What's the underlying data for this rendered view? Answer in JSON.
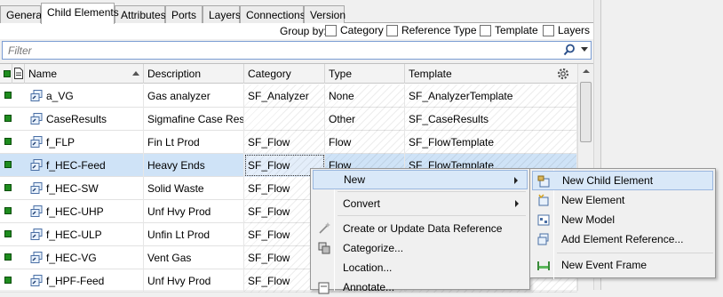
{
  "tabs": [
    "General",
    "Child Elements",
    "Attributes",
    "Ports",
    "Layers",
    "Connections",
    "Version"
  ],
  "group_by": {
    "label": "Group by:",
    "options": [
      "Category",
      "Reference Type",
      "Template",
      "Layers"
    ]
  },
  "filter": {
    "placeholder": "Filter"
  },
  "grid": {
    "columns": [
      "Name",
      "Description",
      "Category",
      "Type",
      "Template"
    ],
    "rows": [
      {
        "name": "a_VG",
        "description": "Gas analyzer",
        "category": "SF_Analyzer",
        "type": "None",
        "template": "SF_AnalyzerTemplate"
      },
      {
        "name": "CaseResults",
        "description": "Sigmafine Case Res...",
        "category": "",
        "type": "Other",
        "template": "SF_CaseResults"
      },
      {
        "name": "f_FLP",
        "description": "Fin Lt Prod",
        "category": "SF_Flow",
        "type": "Flow",
        "template": "SF_FlowTemplate"
      },
      {
        "name": "f_HEC-Feed",
        "description": "Heavy Ends",
        "category": "SF_Flow",
        "type": "Flow",
        "template": "SF_FlowTemplate"
      },
      {
        "name": "f_HEC-SW",
        "description": "Solid Waste",
        "category": "SF_Flow",
        "type": "",
        "template": ""
      },
      {
        "name": "f_HEC-UHP",
        "description": "Unf Hvy Prod",
        "category": "SF_Flow",
        "type": "",
        "template": ""
      },
      {
        "name": "f_HEC-ULP",
        "description": "Unfin Lt Prod",
        "category": "SF_Flow",
        "type": "",
        "template": ""
      },
      {
        "name": "f_HEC-VG",
        "description": "Vent Gas",
        "category": "SF_Flow",
        "type": "",
        "template": ""
      },
      {
        "name": "f_HPF-Feed",
        "description": "Unf Hvy Prod",
        "category": "SF_Flow",
        "type": "",
        "template": ""
      }
    ]
  },
  "context_menu": {
    "items": [
      "New",
      "Convert",
      "Create or Update Data Reference",
      "Categorize...",
      "Location...",
      "Annotate..."
    ]
  },
  "submenu": {
    "items": [
      "New Child Element",
      "New Element",
      "New Model",
      "Add Element Reference...",
      "New Event Frame"
    ]
  },
  "colors": {
    "selection": "#cfe3f7",
    "menu_highlight": "#d9e8f8",
    "status_green": "#1e8c1e"
  }
}
